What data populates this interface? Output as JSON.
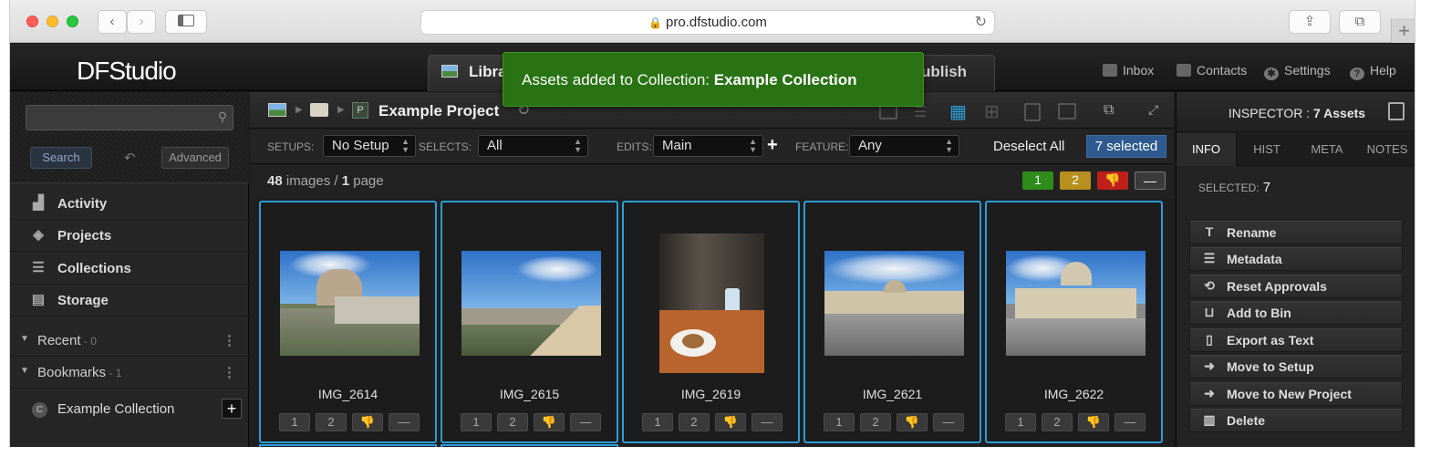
{
  "browser": {
    "url": "pro.dfstudio.com",
    "back_icon": "chevron-left",
    "forward_icon": "chevron-right"
  },
  "app": {
    "logo": "DFStudio",
    "tabs": [
      {
        "label": "Libra",
        "active": true
      },
      {
        "label": "ublish",
        "active": false
      }
    ],
    "nav_right": [
      {
        "label": "Inbox",
        "icon": "inbox-icon"
      },
      {
        "label": "Contacts",
        "icon": "contacts-icon"
      },
      {
        "label": "Settings",
        "icon": "gear-icon"
      },
      {
        "label": "Help",
        "icon": "help-icon"
      }
    ]
  },
  "toast": {
    "prefix": "Assets added to Collection: ",
    "collection": "Example Collection",
    "color": "#297314"
  },
  "sidebar": {
    "search_placeholder": "",
    "search_button": "Search",
    "advanced_button": "Advanced",
    "nav": [
      {
        "label": "Activity",
        "icon": "bar-chart-icon"
      },
      {
        "label": "Projects",
        "icon": "layers-icon"
      },
      {
        "label": "Collections",
        "icon": "database-icon"
      },
      {
        "label": "Storage",
        "icon": "storage-icon"
      }
    ],
    "sections": [
      {
        "label": "Recent",
        "count": " - 0"
      },
      {
        "label": "Bookmarks",
        "count": " - 1"
      }
    ],
    "bookmark_item": {
      "label": "Example Collection",
      "badge": "C"
    }
  },
  "main": {
    "breadcrumb": {
      "badge": "P",
      "title": "Example Project"
    },
    "filters": {
      "setups_label": "SETUPS:",
      "setups_value": "No Setup",
      "selects_label": "SELECTS:",
      "selects_value": "All",
      "edits_label": "EDITS:",
      "edits_value": "Main",
      "feature_label": "FEATURE:",
      "feature_value": "Any",
      "deselect_all": "Deselect All",
      "selected_count": "7 selected"
    },
    "counts": {
      "images": "48",
      "images_label": " images / ",
      "pages": "1",
      "pages_label": " page"
    },
    "rating_buttons": [
      {
        "label": "1",
        "color": "#2e8b1c"
      },
      {
        "label": "2",
        "color": "#b8901f"
      },
      {
        "label": "👎",
        "color": "#c0201c"
      },
      {
        "label": "—",
        "color": "#3a3a3a"
      }
    ],
    "thumbnails": [
      {
        "name": "IMG_2614"
      },
      {
        "name": "IMG_2615"
      },
      {
        "name": "IMG_2619"
      },
      {
        "name": "IMG_2621"
      },
      {
        "name": "IMG_2622"
      }
    ],
    "thumb_buttons": [
      "1",
      "2",
      "👎",
      "—"
    ]
  },
  "inspector": {
    "title_prefix": "INSPECTOR : ",
    "title_count": "7 Assets",
    "tabs": [
      "INFO",
      "HIST",
      "META",
      "NOTES"
    ],
    "selected_label": "SELECTED:",
    "selected_value": "7",
    "actions": [
      {
        "label": "Rename",
        "icon": "rename-icon"
      },
      {
        "label": "Metadata",
        "icon": "list-icon"
      },
      {
        "label": "Reset Approvals",
        "icon": "reset-icon"
      },
      {
        "label": "Add to Bin",
        "icon": "basket-icon"
      },
      {
        "label": "Export as Text",
        "icon": "document-icon"
      },
      {
        "label": "Move to Setup",
        "icon": "arrow-right-icon"
      },
      {
        "label": "Move to New Project",
        "icon": "arrow-right-icon"
      },
      {
        "label": "Delete",
        "icon": "trash-icon"
      }
    ]
  }
}
